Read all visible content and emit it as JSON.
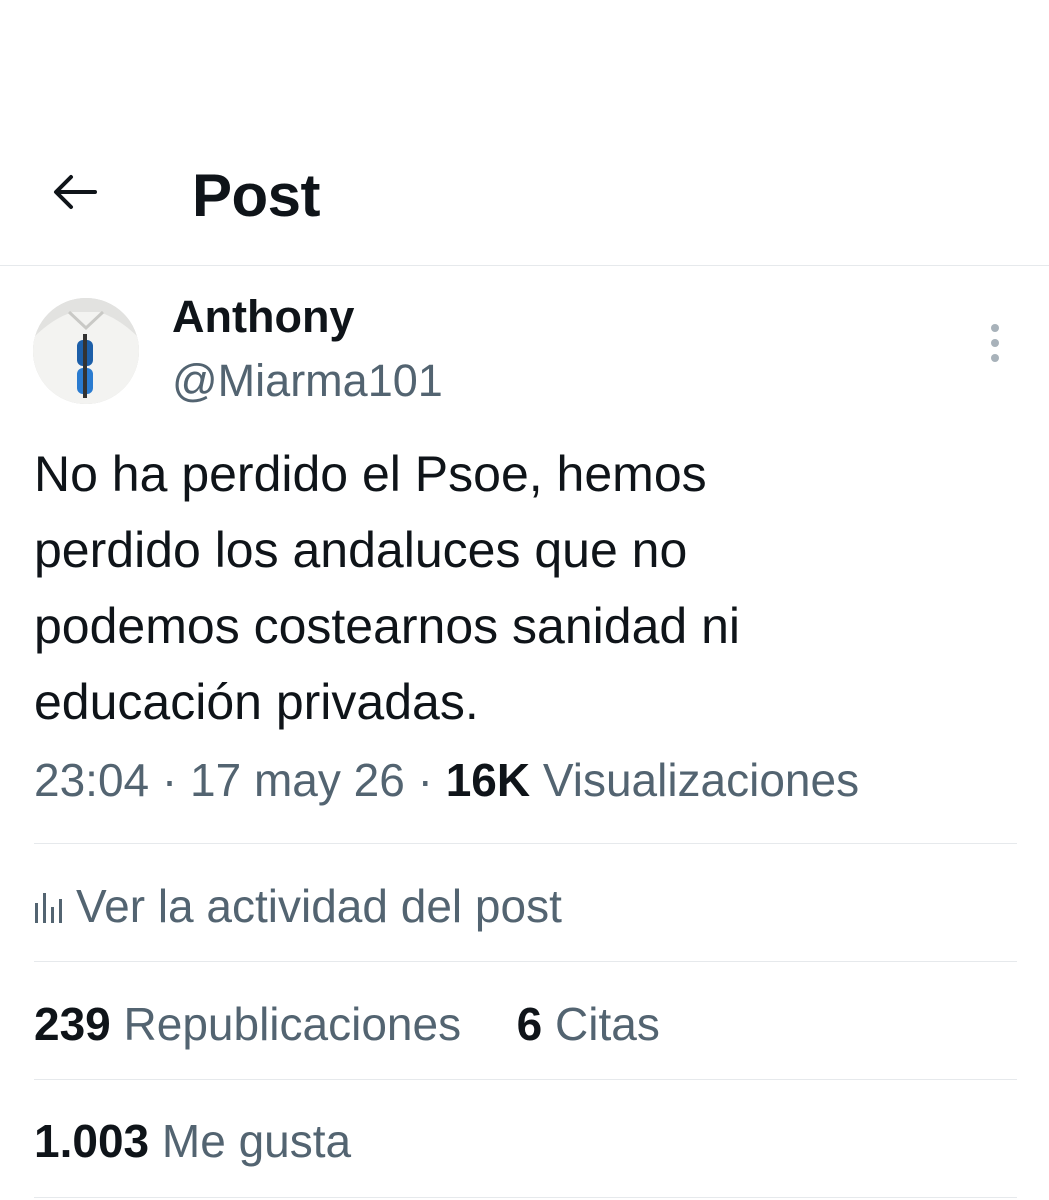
{
  "header": {
    "title": "Post"
  },
  "author": {
    "name": "Anthony",
    "handle": "@Miarma101"
  },
  "post": {
    "text": "No ha perdido el Psoe, hemos\nperdido los andaluces que no\npodemos costearnos sanidad ni\neducación privadas.",
    "time": "23:04",
    "date": "17 may 26",
    "views_count": "16K",
    "views_label": "Visualizaciones"
  },
  "activity": {
    "label": "Ver la actividad del post",
    "icon": "analytics-icon"
  },
  "stats": {
    "reposts_count": "239",
    "reposts_label": "Republicaciones",
    "quotes_count": "6",
    "quotes_label": "Citas",
    "likes_count": "1.003",
    "likes_label": "Me gusta"
  },
  "colors": {
    "text": "#0f1419",
    "secondary": "#536471",
    "divider": "#e6e9ec"
  }
}
